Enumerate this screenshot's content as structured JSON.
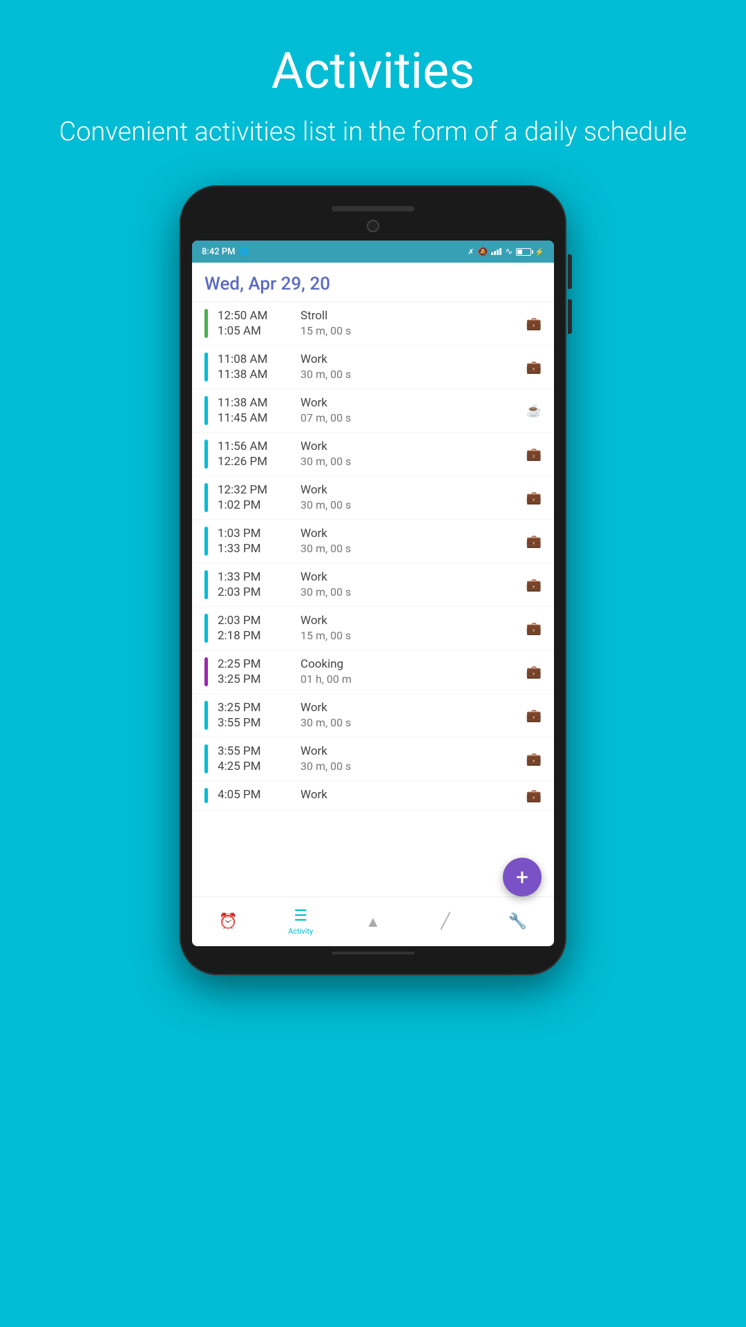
{
  "header": {
    "title": "Activities",
    "subtitle": "Convenient activities list in the form of a daily schedule"
  },
  "phone": {
    "statusBar": {
      "time": "8:42 PM",
      "batteryPercent": "41"
    },
    "dateHeader": "Wed, Apr 29, 20",
    "activities": [
      {
        "id": 1,
        "startTime": "12:50 AM",
        "endTime": "1:05 AM",
        "name": "Stroll",
        "duration": "15 m, 00 s",
        "barColor": "#4CAF50",
        "iconType": "briefcase"
      },
      {
        "id": 2,
        "startTime": "11:08 AM",
        "endTime": "11:38 AM",
        "name": "Work",
        "duration": "30 m, 00 s",
        "barColor": "#00BCD4",
        "iconType": "briefcase"
      },
      {
        "id": 3,
        "startTime": "11:38 AM",
        "endTime": "11:45 AM",
        "name": "Work",
        "duration": "07 m, 00 s",
        "barColor": "#00BCD4",
        "iconType": "coffee"
      },
      {
        "id": 4,
        "startTime": "11:56 AM",
        "endTime": "12:26 PM",
        "name": "Work",
        "duration": "30 m, 00 s",
        "barColor": "#00BCD4",
        "iconType": "briefcase"
      },
      {
        "id": 5,
        "startTime": "12:32 PM",
        "endTime": "1:02 PM",
        "name": "Work",
        "duration": "30 m, 00 s",
        "barColor": "#00BCD4",
        "iconType": "briefcase"
      },
      {
        "id": 6,
        "startTime": "1:03 PM",
        "endTime": "1:33 PM",
        "name": "Work",
        "duration": "30 m, 00 s",
        "barColor": "#00BCD4",
        "iconType": "briefcase"
      },
      {
        "id": 7,
        "startTime": "1:33 PM",
        "endTime": "2:03 PM",
        "name": "Work",
        "duration": "30 m, 00 s",
        "barColor": "#00BCD4",
        "iconType": "briefcase"
      },
      {
        "id": 8,
        "startTime": "2:03 PM",
        "endTime": "2:18 PM",
        "name": "Work",
        "duration": "15 m, 00 s",
        "barColor": "#00BCD4",
        "iconType": "briefcase"
      },
      {
        "id": 9,
        "startTime": "2:25 PM",
        "endTime": "3:25 PM",
        "name": "Cooking",
        "duration": "01 h, 00 m",
        "barColor": "#9C27B0",
        "iconType": "briefcase"
      },
      {
        "id": 10,
        "startTime": "3:25 PM",
        "endTime": "3:55 PM",
        "name": "Work",
        "duration": "30 m, 00 s",
        "barColor": "#00BCD4",
        "iconType": "briefcase"
      },
      {
        "id": 11,
        "startTime": "3:55 PM",
        "endTime": "4:25 PM",
        "name": "Work",
        "duration": "30 m, 00 s",
        "barColor": "#00BCD4",
        "iconType": "briefcase"
      },
      {
        "id": 12,
        "startTime": "4:05 PM",
        "endTime": "",
        "name": "Work",
        "duration": "",
        "barColor": "#00BCD4",
        "iconType": "briefcase"
      }
    ],
    "bottomNav": [
      {
        "id": "alarm",
        "label": "",
        "iconType": "alarm",
        "active": false
      },
      {
        "id": "activity",
        "label": "Activity",
        "iconType": "list",
        "active": true
      },
      {
        "id": "shapes",
        "label": "",
        "iconType": "shapes",
        "active": false
      },
      {
        "id": "stats",
        "label": "",
        "iconType": "stats",
        "active": false
      },
      {
        "id": "settings",
        "label": "",
        "iconType": "settings",
        "active": false
      }
    ],
    "fab": {
      "label": "+"
    }
  }
}
